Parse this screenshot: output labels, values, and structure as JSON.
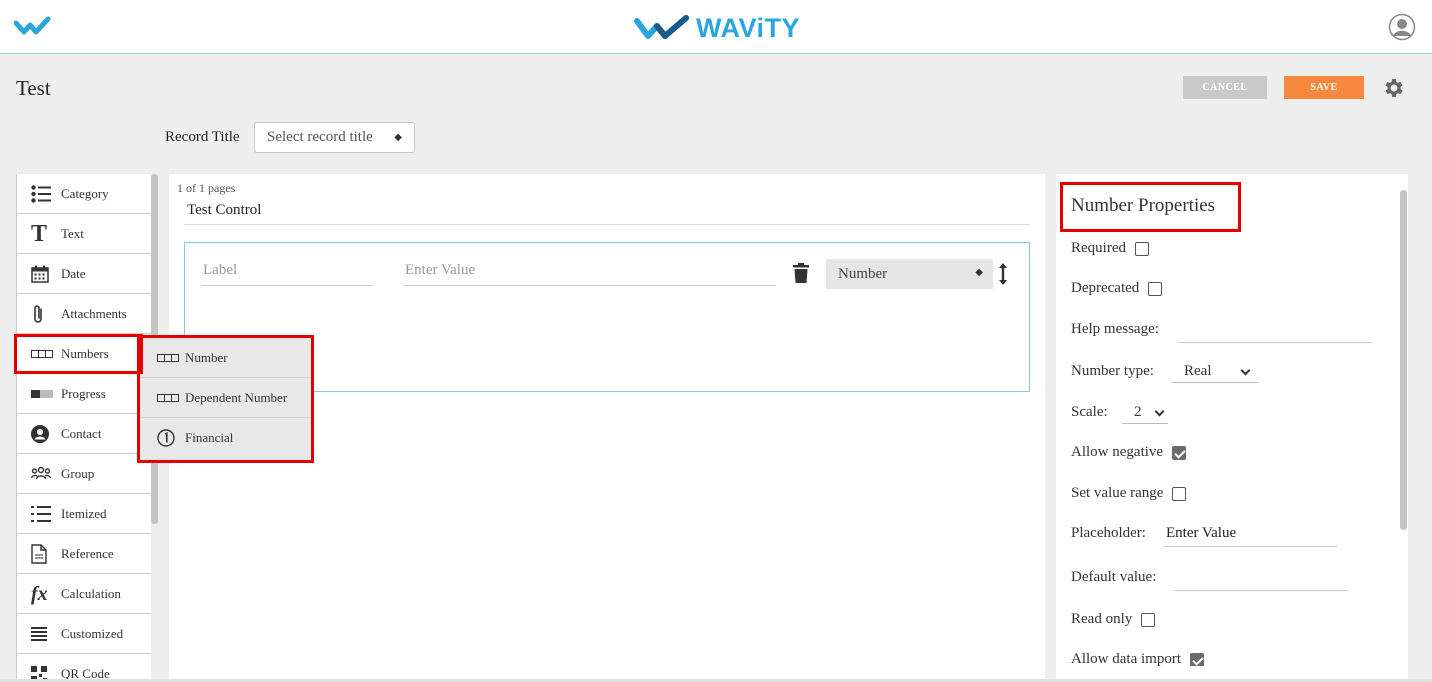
{
  "brand": {
    "name": "WAViTY",
    "color": "#2aa6de"
  },
  "colors": {
    "accent_red": "#e60000",
    "save": "#f7893e",
    "cancel": "#c9c9c9"
  },
  "header": {
    "title": "Test",
    "cancel_label": "CANCEL",
    "save_label": "SAVE"
  },
  "record_title": {
    "label": "Record Title",
    "placeholder": "Select record title"
  },
  "palette": {
    "items": [
      {
        "label": "Category",
        "icon": "list-icon"
      },
      {
        "label": "Text",
        "icon": "text-t-icon"
      },
      {
        "label": "Date",
        "icon": "calendar-icon"
      },
      {
        "label": "Attachments",
        "icon": "paperclip-icon"
      },
      {
        "label": "Numbers",
        "icon": "number-box-icon"
      },
      {
        "label": "Progress",
        "icon": "progress-icon"
      },
      {
        "label": "Contact",
        "icon": "contact-icon"
      },
      {
        "label": "Group",
        "icon": "group-icon"
      },
      {
        "label": "Itemized",
        "icon": "itemized-list-icon"
      },
      {
        "label": "Reference",
        "icon": "document-icon"
      },
      {
        "label": "Calculation",
        "icon": "fx-icon"
      },
      {
        "label": "Customized",
        "icon": "lines-icon"
      },
      {
        "label": "QR Code",
        "icon": "qr-icon"
      }
    ]
  },
  "submenu": {
    "items": [
      {
        "label": "Number",
        "icon": "number-box-icon"
      },
      {
        "label": "Dependent Number",
        "icon": "number-box-icon"
      },
      {
        "label": "Financial",
        "icon": "circled-one-icon"
      }
    ]
  },
  "canvas": {
    "pages": "1 of 1 pages",
    "section_title": "Test Control",
    "label_placeholder": "Label",
    "value_placeholder": "Enter Value",
    "type_value": "Number"
  },
  "properties": {
    "title": "Number Properties",
    "required": {
      "label": "Required",
      "checked": false
    },
    "deprecated": {
      "label": "Deprecated",
      "checked": false
    },
    "help_message": {
      "label": "Help message:",
      "value": ""
    },
    "number_type": {
      "label": "Number type:",
      "value": "Real"
    },
    "scale": {
      "label": "Scale:",
      "value": "2"
    },
    "allow_negative": {
      "label": "Allow negative",
      "checked": true
    },
    "value_range": {
      "label": "Set value range",
      "checked": false
    },
    "placeholder": {
      "label": "Placeholder:",
      "value": "Enter Value"
    },
    "default_value": {
      "label": "Default value:",
      "value": ""
    },
    "read_only": {
      "label": "Read only",
      "checked": false
    },
    "allow_import": {
      "label": "Allow data import",
      "checked": true
    }
  }
}
